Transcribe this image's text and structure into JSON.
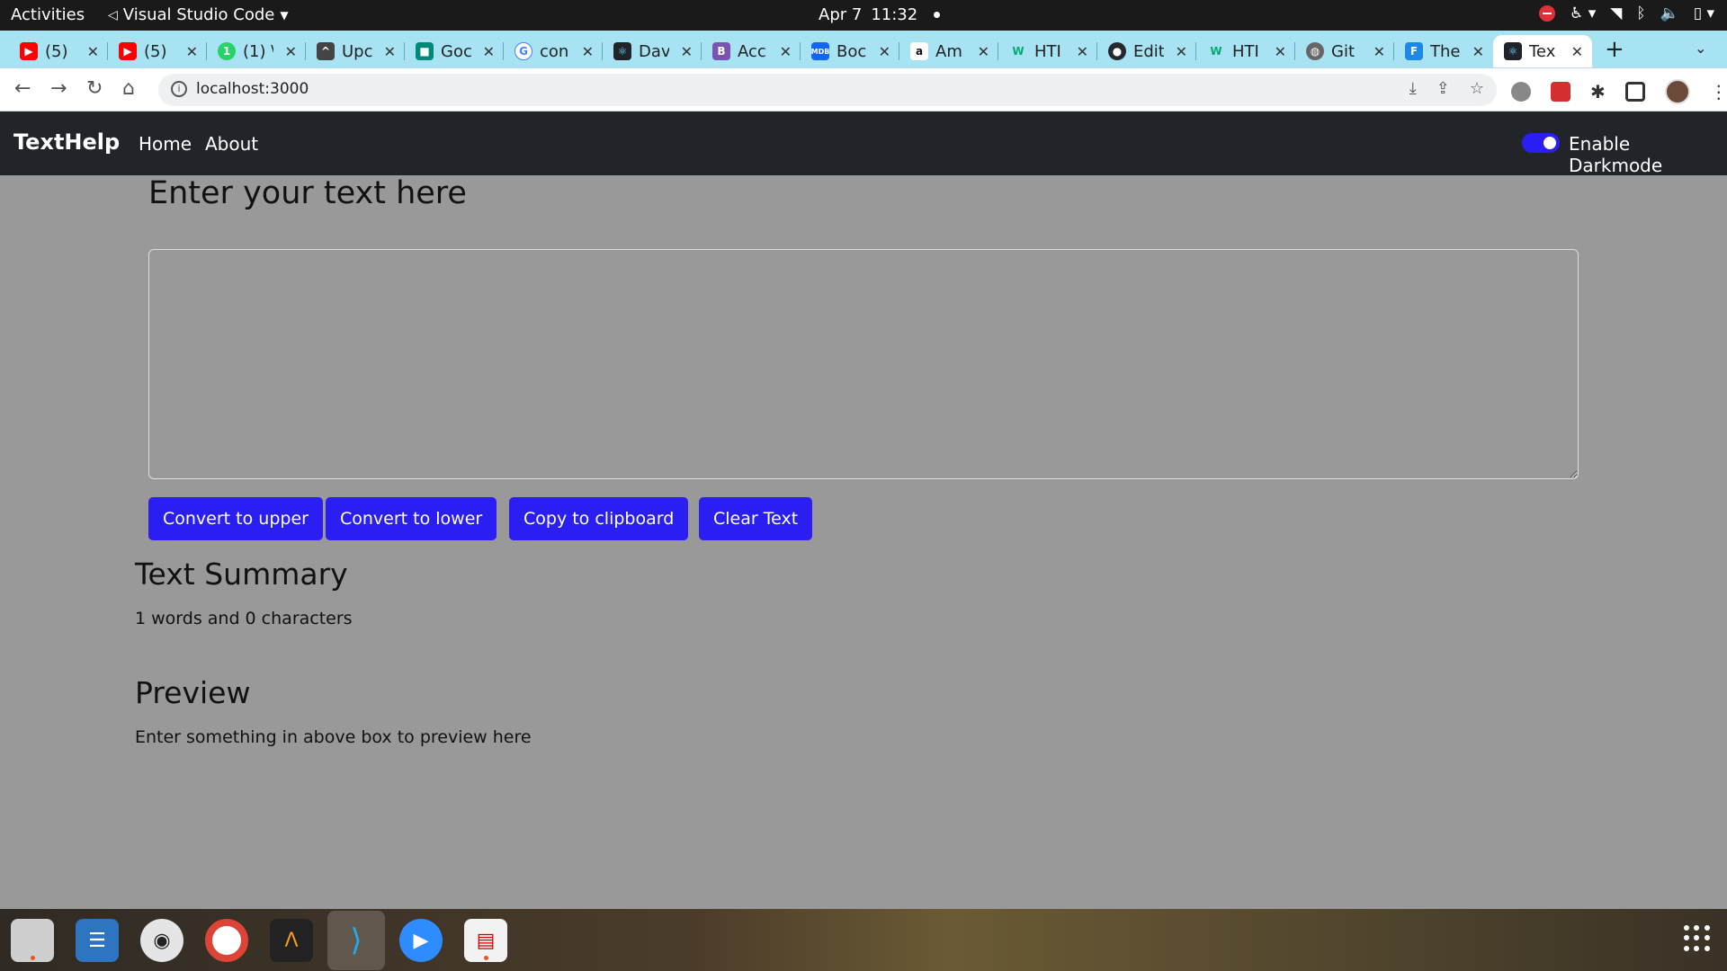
{
  "system_bar": {
    "activities": "Activities",
    "app_name": "Visual Studio Code",
    "date": "Apr 7",
    "time": "11:32"
  },
  "browser": {
    "tabs": [
      {
        "label": "(5)",
        "favicon": "youtube-icon",
        "color": "#ff0000"
      },
      {
        "label": "(5)",
        "favicon": "youtube-icon",
        "color": "#ff0000"
      },
      {
        "label": "(1) \\",
        "favicon": "whatsapp-icon",
        "color": "#25d366"
      },
      {
        "label": "Upc",
        "favicon": "upwork-icon",
        "color": "#444444"
      },
      {
        "label": "Goc",
        "favicon": "google-meet-icon",
        "color": "#00897b"
      },
      {
        "label": "con",
        "favicon": "google-icon",
        "color": "#4285f4"
      },
      {
        "label": "Dav",
        "favicon": "react-icon",
        "color": "#20232a"
      },
      {
        "label": "Acc",
        "favicon": "bootstrap-icon",
        "color": "#7952b3"
      },
      {
        "label": "Boc",
        "favicon": "mdb-icon",
        "color": "#1266f1"
      },
      {
        "label": "Am",
        "favicon": "amazon-icon",
        "color": "#222222"
      },
      {
        "label": "HTI",
        "favicon": "w3schools-icon",
        "color": "#04aa6d"
      },
      {
        "label": "Edit",
        "favicon": "github-icon",
        "color": "#24292e"
      },
      {
        "label": "HTI",
        "favicon": "w3schools-icon",
        "color": "#04aa6d"
      },
      {
        "label": "Git",
        "favicon": "globe-icon",
        "color": "#666666"
      },
      {
        "label": "The",
        "favicon": "freecodecamp-icon",
        "color": "#1e88e5"
      },
      {
        "label": "Tex",
        "favicon": "react-icon",
        "color": "#20232a"
      }
    ],
    "url": "localhost:3000"
  },
  "app": {
    "brand": "TextHelp",
    "nav": [
      "Home",
      "About"
    ],
    "darkmode_label": "Enable Darkmode",
    "heading": "Enter your text here",
    "textarea_value": "",
    "buttons": {
      "upper": "Convert to upper",
      "lower": "Convert to lower",
      "copy": "Copy to clipboard",
      "clear": "Clear Text"
    },
    "summary_heading": "Text Summary",
    "summary_text": "1 words and 0 characters",
    "preview_heading": "Preview",
    "preview_text": "Enter something in above box to preview here",
    "colors": {
      "navbar": "#212529",
      "button": "#2b1ef2",
      "background": "#999999"
    }
  },
  "dock": {
    "apps": [
      "files-icon",
      "text-editor-icon",
      "rhythmbox-icon",
      "chrome-icon",
      "arduino-icon",
      "vscode-icon",
      "zoom-icon",
      "document-viewer-icon"
    ]
  }
}
